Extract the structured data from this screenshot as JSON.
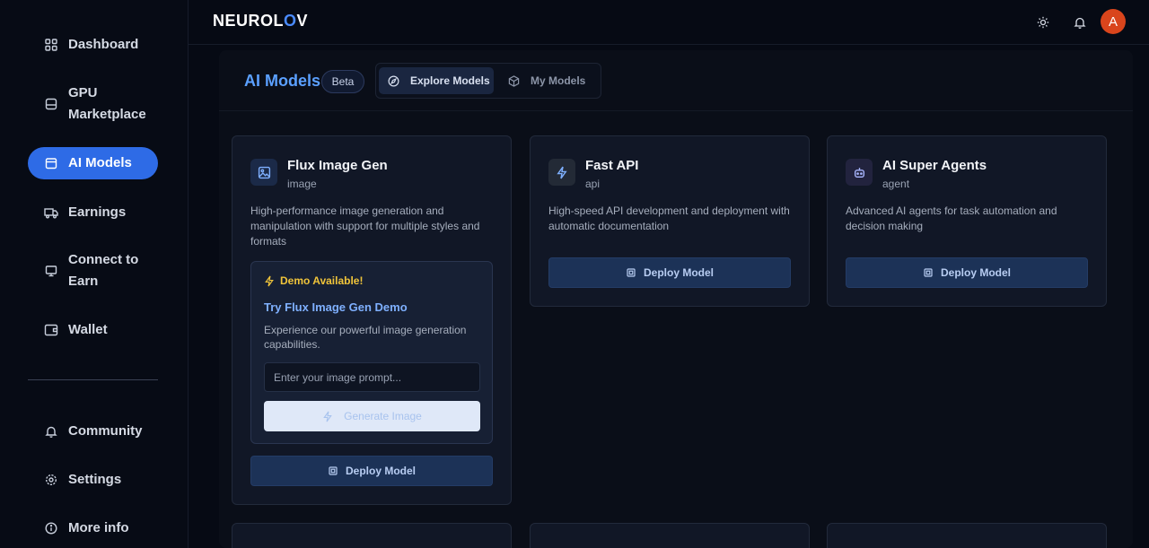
{
  "app": {
    "logo": "NEUROLOV"
  },
  "sidebar": {
    "items": [
      {
        "label": "Dashboard",
        "icon": "dashboard-grid-icon"
      },
      {
        "label": "GPU Marketplace",
        "icon": "server-icon"
      },
      {
        "label": "AI Models",
        "icon": "calendar-icon",
        "active": true
      },
      {
        "label": "Earnings",
        "icon": "truck-icon"
      },
      {
        "label": "Connect to Earn",
        "icon": "monitor-icon"
      },
      {
        "label": "Wallet",
        "icon": "wallet-icon"
      }
    ],
    "bottom_items": [
      {
        "label": "Community",
        "icon": "bell-icon"
      },
      {
        "label": "Settings",
        "icon": "gear-icon"
      },
      {
        "label": "More info",
        "icon": "info-icon"
      }
    ]
  },
  "topbar": {
    "avatar_initial": "A"
  },
  "page": {
    "title": "AI Models",
    "badge": "Beta",
    "tabs": [
      {
        "label": "Explore Models",
        "icon": "compass-icon",
        "active": true
      },
      {
        "label": "My Models",
        "icon": "cube-icon",
        "active": false
      }
    ]
  },
  "models": [
    {
      "title": "Flux Image Gen",
      "type": "image",
      "description": "High-performance image generation and manipulation with support for multiple styles and formats",
      "icon": "image-icon",
      "deploy_label": "Deploy Model",
      "demo": {
        "badge": "Demo Available!",
        "title": "Try Flux Image Gen Demo",
        "description": "Experience our powerful image generation capabilities.",
        "input_placeholder": "Enter your image prompt...",
        "button_label": "Generate Image"
      }
    },
    {
      "title": "Fast API",
      "type": "api",
      "description": "High-speed API development and deployment with automatic documentation",
      "icon": "lightning-icon",
      "deploy_label": "Deploy Model"
    },
    {
      "title": "AI Super Agents",
      "type": "agent",
      "description": "Advanced AI agents for task automation and decision making",
      "icon": "robot-icon",
      "deploy_label": "Deploy Model"
    }
  ],
  "colors": {
    "accent": "#2e6be6",
    "title_blue": "#5ba0ff",
    "demo_yellow": "#f0c43a",
    "avatar": "#d9451c"
  }
}
